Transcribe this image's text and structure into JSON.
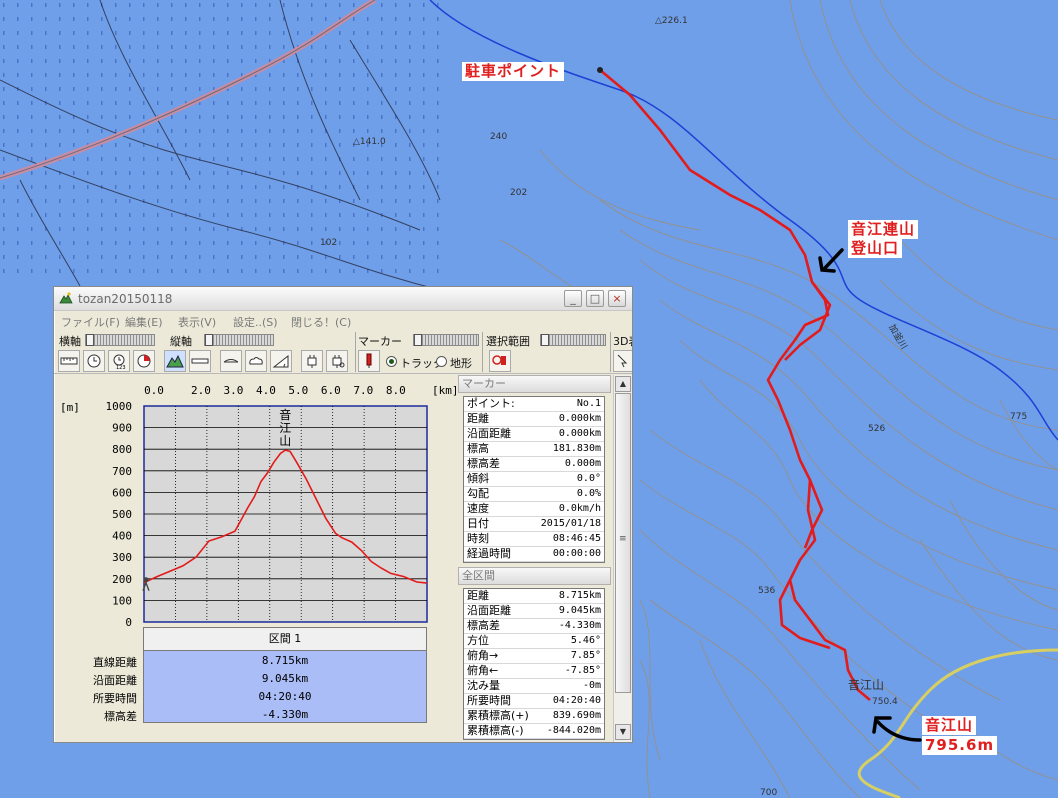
{
  "map": {
    "labels": {
      "parking": "駐車ポイント",
      "trailhead_line1": "音江連山",
      "trailhead_line2": "登山口",
      "summit_line1": "音江山",
      "summit_line2": "795.6m"
    },
    "spot_heights": [
      "△141.0",
      "202",
      "102",
      "240",
      "775",
      "536",
      "750.4",
      "526",
      "700",
      "△226.1"
    ],
    "map_name": "音江山",
    "river_name": "加釜川",
    "colors": {
      "background": "#6f9fe9",
      "track": "#e31b1b",
      "contour": "#a58b64",
      "road": "#c98ca3"
    }
  },
  "window": {
    "title": "tozan20150118",
    "icon": "mountain-app-icon",
    "buttons": {
      "minimize": "_",
      "maximize": "□",
      "close": "×"
    },
    "menu": [
      "ファイル(F)",
      "編集(E)",
      "表示(V)",
      "設定..(S)",
      "閉じる！(C)"
    ],
    "toolbar": {
      "x_axis_label": "横軸",
      "y_axis_label": "縦軸",
      "marker_label": "マーカー",
      "range_label": "選択範囲",
      "threed_label": "3D表",
      "radio_track": "トラック",
      "radio_terrain": "地形",
      "clock_number": "123",
      "icons": [
        "ruler-icon",
        "clock-icon",
        "clock-123-icon",
        "pie-clock-icon",
        "mountain-profile-icon",
        "ruler-small-icon",
        "cloud-icon",
        "cloud-shape-icon",
        "slope-angle-icon",
        "plug-icon",
        "plug-settings-icon",
        "marker-pin-icon",
        "track-marker-icon",
        "pointer-icon"
      ]
    }
  },
  "chart_data": {
    "type": "line",
    "title": "",
    "xlabel": "[km]",
    "ylabel": "[m]",
    "x_ticks": [
      "0.0",
      "2.0",
      "3.0",
      "4.0",
      "5.0",
      "6.0",
      "7.0",
      "8.0"
    ],
    "y_ticks": [
      "1000",
      "900",
      "800",
      "700",
      "600",
      "500",
      "400",
      "300",
      "200",
      "100",
      "0"
    ],
    "xlim": [
      0,
      8.715
    ],
    "ylim": [
      0,
      1000
    ],
    "grid": true,
    "annotation": "音江山",
    "series": [
      {
        "x": [
          0.0,
          0.4,
          0.8,
          1.2,
          1.6,
          2.0,
          2.4,
          2.8,
          3.2,
          3.4,
          3.6,
          3.8,
          4.0,
          4.2,
          4.35,
          4.5,
          4.7,
          5.0,
          5.3,
          5.6,
          5.9,
          6.1,
          6.4,
          6.7,
          7.0,
          7.3,
          7.6,
          8.0,
          8.4,
          8.715
        ],
        "y": [
          182,
          210,
          235,
          260,
          300,
          375,
          395,
          420,
          530,
          580,
          650,
          690,
          740,
          780,
          796,
          790,
          740,
          660,
          570,
          480,
          410,
          390,
          370,
          330,
          280,
          250,
          225,
          210,
          185,
          180
        ]
      }
    ]
  },
  "summary": {
    "header": "区間 1",
    "rows": [
      {
        "label": "直線距離",
        "value": "8.715km"
      },
      {
        "label": "沿面距離",
        "value": "9.045km"
      },
      {
        "label": "所要時間",
        "value": "04:20:40"
      },
      {
        "label": "標高差",
        "value": "-4.330m"
      }
    ]
  },
  "marker_panel": {
    "title": "マーカー",
    "rows": [
      {
        "k": "ポイント:",
        "v": "No.1"
      },
      {
        "k": "距離",
        "v": "0.000km"
      },
      {
        "k": "沿面距離",
        "v": "0.000km"
      },
      {
        "k": "標高",
        "v": "181.830m"
      },
      {
        "k": "標高差",
        "v": "0.000m"
      },
      {
        "k": "傾斜",
        "v": "0.0°"
      },
      {
        "k": "勾配",
        "v": "0.0%"
      },
      {
        "k": "速度",
        "v": "0.0km/h"
      },
      {
        "k": "日付",
        "v": "2015/01/18"
      },
      {
        "k": "時刻",
        "v": "08:46:45"
      },
      {
        "k": "経過時間",
        "v": "00:00:00"
      }
    ]
  },
  "total_panel": {
    "title": "全区間",
    "rows": [
      {
        "k": "距離",
        "v": "8.715km"
      },
      {
        "k": "沿面距離",
        "v": "9.045km"
      },
      {
        "k": "標高差",
        "v": "-4.330m"
      },
      {
        "k": "方位",
        "v": "5.46°"
      },
      {
        "k": "俯角→",
        "v": "7.85°"
      },
      {
        "k": "俯角←",
        "v": "-7.85°"
      },
      {
        "k": "沈み量",
        "v": "-0m"
      },
      {
        "k": "所要時間",
        "v": "04:20:40"
      },
      {
        "k": "累積標高(+)",
        "v": "839.690m"
      },
      {
        "k": "累積標高(-)",
        "v": "-844.020m"
      }
    ]
  },
  "scrollbar": {
    "up": "▲",
    "down": "▼",
    "grip": "≡"
  }
}
